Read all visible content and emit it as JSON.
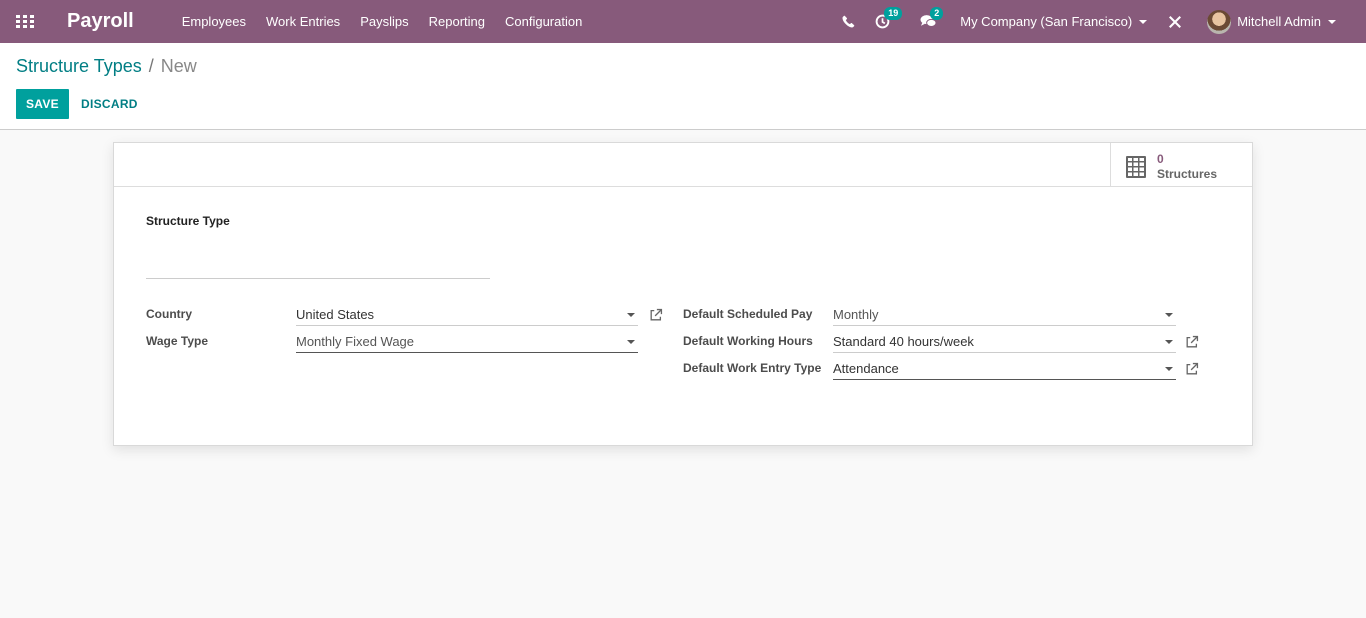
{
  "navbar": {
    "app_name": "Payroll",
    "menu": [
      "Employees",
      "Work Entries",
      "Payslips",
      "Reporting",
      "Configuration"
    ],
    "activity_count": "19",
    "message_count": "2",
    "company": "My Company (San Francisco)",
    "user": "Mitchell Admin"
  },
  "breadcrumb": {
    "parent": "Structure Types",
    "separator": "/",
    "current": "New"
  },
  "buttons": {
    "save": "SAVE",
    "discard": "DISCARD"
  },
  "smart_button": {
    "value": "0",
    "label": "Structures"
  },
  "form": {
    "title_label": "Structure Type",
    "title_value": "",
    "left": {
      "country_label": "Country",
      "country_value": "United States",
      "wage_type_label": "Wage Type",
      "wage_type_value": "Monthly Fixed Wage"
    },
    "right": {
      "scheduled_pay_label": "Default Scheduled Pay",
      "scheduled_pay_value": "Monthly",
      "working_hours_label": "Default Working Hours",
      "working_hours_value": "Standard 40 hours/week",
      "work_entry_label": "Default Work Entry Type",
      "work_entry_value": "Attendance"
    }
  },
  "colors": {
    "navbar": "#875a7b",
    "primary": "#00a09d",
    "link": "#017e84"
  }
}
